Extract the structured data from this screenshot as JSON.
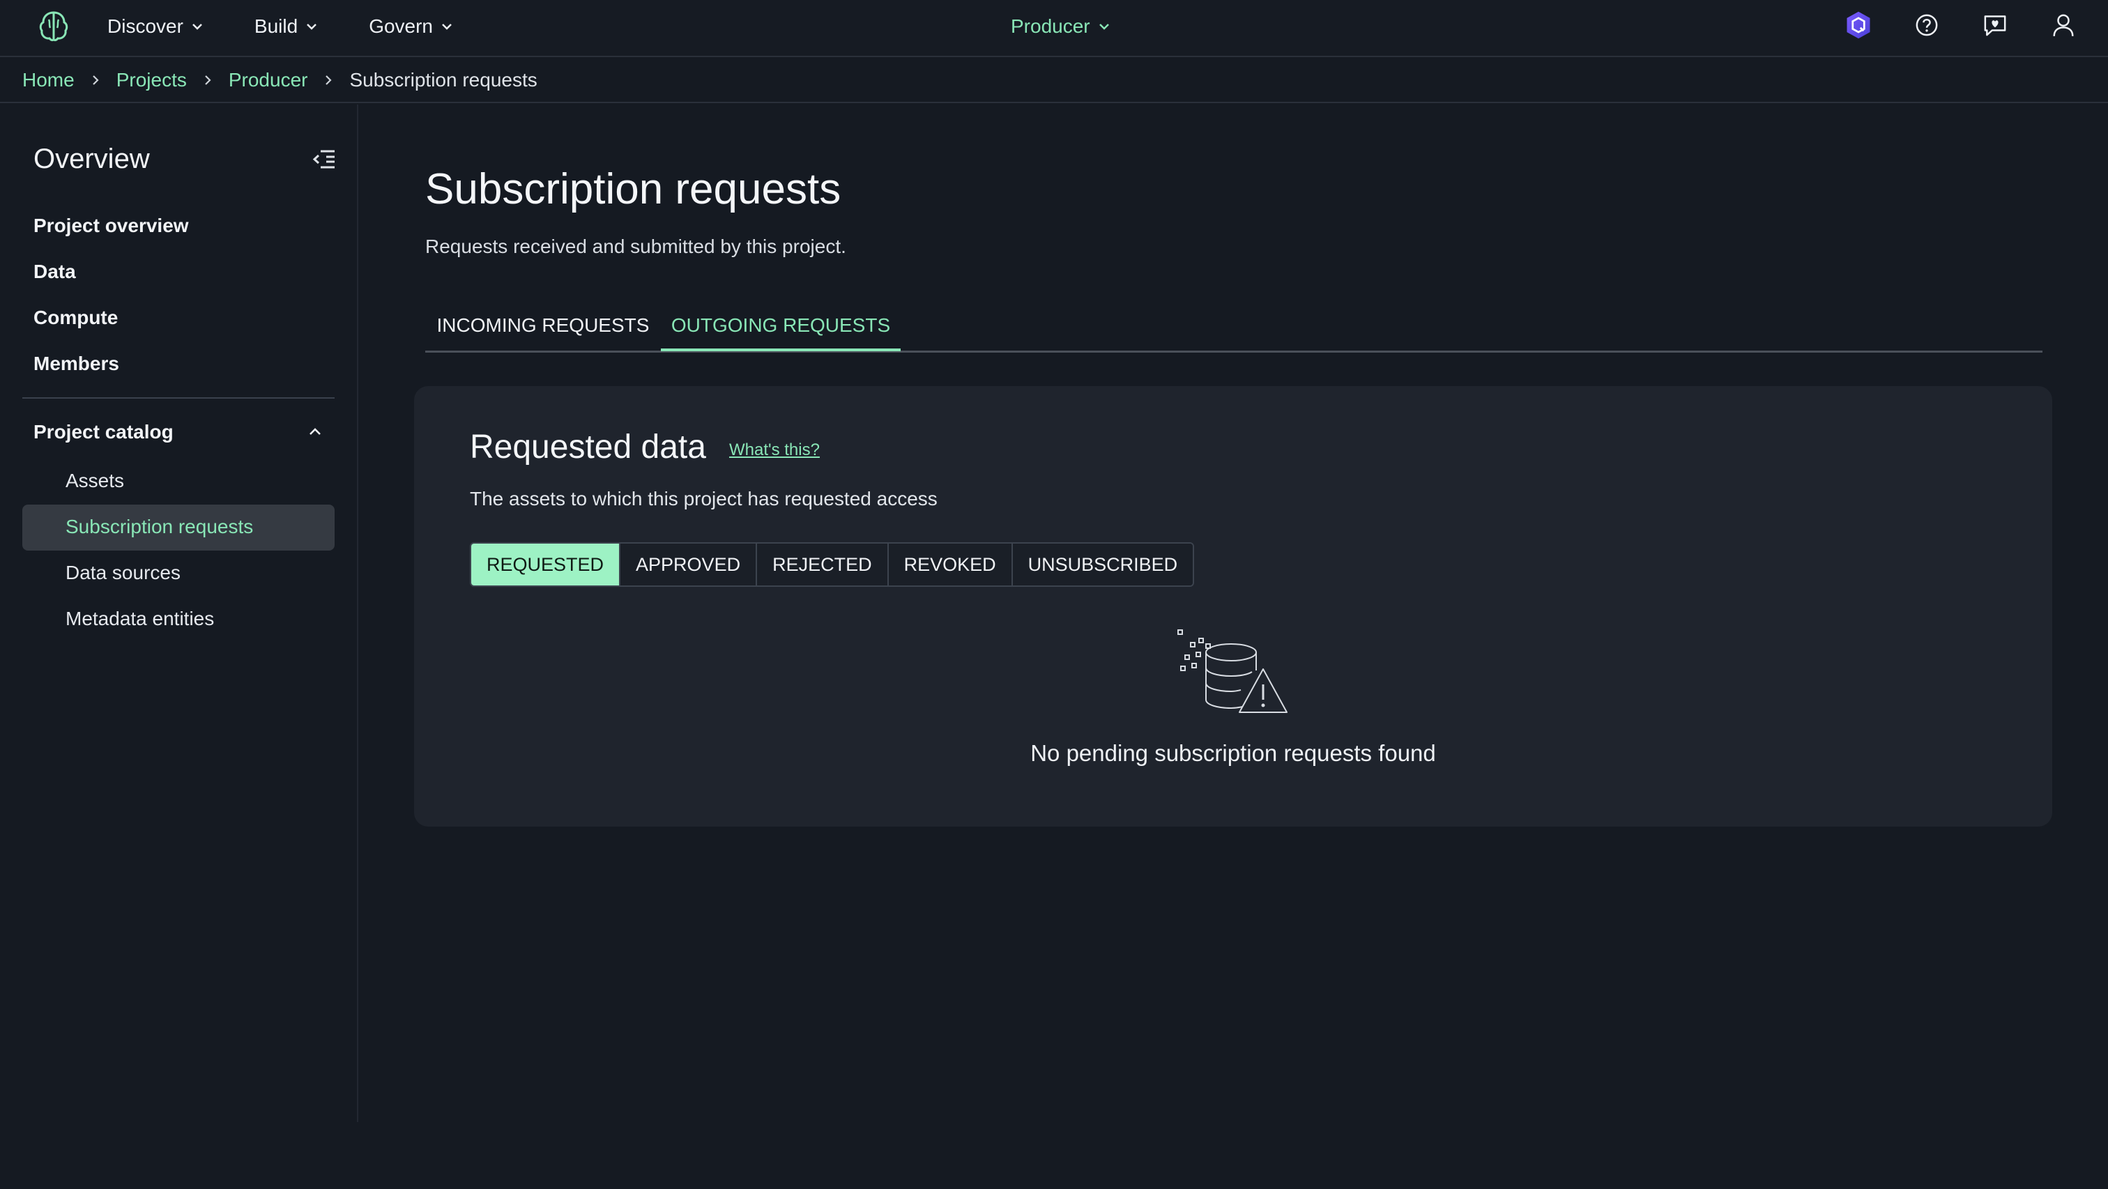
{
  "topnav": {
    "menus": [
      {
        "label": "Discover"
      },
      {
        "label": "Build"
      },
      {
        "label": "Govern"
      }
    ],
    "project": "Producer",
    "icons": [
      "amazon-q-icon",
      "help-icon",
      "feedback-icon",
      "user-icon"
    ]
  },
  "breadcrumb": [
    "Home",
    "Projects",
    "Producer",
    "Subscription requests"
  ],
  "sidebar": {
    "title": "Overview",
    "links": [
      "Project overview",
      "Data",
      "Compute",
      "Members"
    ],
    "catalog": {
      "label": "Project catalog",
      "items": [
        "Assets",
        "Subscription requests",
        "Data sources",
        "Metadata entities"
      ],
      "active": "Subscription requests"
    }
  },
  "main": {
    "title": "Subscription requests",
    "description": "Requests received and submitted by this project.",
    "tabs": [
      "INCOMING REQUESTS",
      "OUTGOING REQUESTS"
    ],
    "active_tab": "OUTGOING REQUESTS"
  },
  "panel": {
    "title": "Requested data",
    "help_link": "What's this?",
    "description": "The assets to which this project has requested access",
    "filters": [
      "REQUESTED",
      "APPROVED",
      "REJECTED",
      "REVOKED",
      "UNSUBSCRIBED"
    ],
    "active_filter": "REQUESTED",
    "empty_message": "No pending subscription requests found"
  },
  "colors": {
    "accent": "#89e6b6",
    "background": "#151a22",
    "panel": "#1f242d"
  }
}
